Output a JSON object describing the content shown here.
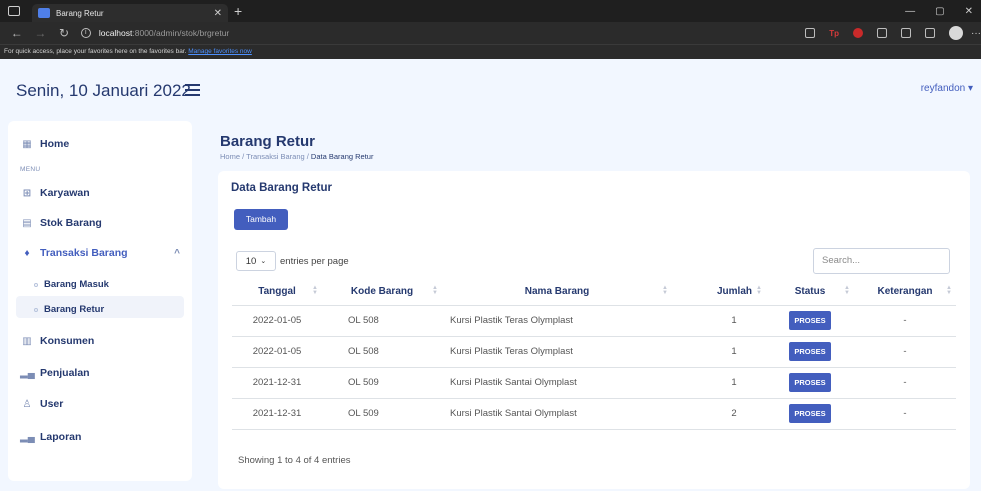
{
  "browser": {
    "tab_title": "Barang Retur",
    "url_host": "localhost",
    "url_path": ":8000/admin/stok/brgretur",
    "favbar_text": "For quick access, place your favorites here on the favorites bar.",
    "favbar_link": "Manage favorites now",
    "tp_label": "Tp"
  },
  "header": {
    "date": "Senin, 10 Januari 2022",
    "user": "reyfandon ▾"
  },
  "sidebar": {
    "home": "Home",
    "menu_label": "MENU",
    "items": [
      {
        "label": "Karyawan",
        "icon": "id-card-icon"
      },
      {
        "label": "Stok Barang",
        "icon": "keyboard-icon"
      },
      {
        "label": "Transaksi Barang",
        "icon": "gem-icon"
      },
      {
        "label": "Konsumen",
        "icon": "grid-icon"
      },
      {
        "label": "Penjualan",
        "icon": "bar-chart-icon"
      },
      {
        "label": "User",
        "icon": "person-icon"
      },
      {
        "label": "Laporan",
        "icon": "bar-chart-icon"
      }
    ],
    "sub_items": [
      "Barang Masuk",
      "Barang Retur"
    ]
  },
  "page": {
    "title": "Barang Retur",
    "breadcrumb": [
      "Home",
      "Transaksi Barang",
      "Data Barang Retur"
    ]
  },
  "card": {
    "title": "Data Barang Retur",
    "add_button": "Tambah",
    "entries_value": "10",
    "entries_label": "entries per page",
    "search_placeholder": "Search...",
    "columns": [
      "Tanggal",
      "Kode Barang",
      "Nama Barang",
      "Jumlah",
      "Status",
      "Keterangan"
    ],
    "rows": [
      {
        "tanggal": "2022-01-05",
        "kode": "OL 508",
        "nama": "Kursi Plastik Teras Olymplast",
        "jumlah": "1",
        "status": "PROSES",
        "ket": "-"
      },
      {
        "tanggal": "2022-01-05",
        "kode": "OL 508",
        "nama": "Kursi Plastik Teras Olymplast",
        "jumlah": "1",
        "status": "PROSES",
        "ket": "-"
      },
      {
        "tanggal": "2021-12-31",
        "kode": "OL 509",
        "nama": "Kursi Plastik Santai Olymplast",
        "jumlah": "1",
        "status": "PROSES",
        "ket": "-"
      },
      {
        "tanggal": "2021-12-31",
        "kode": "OL 509",
        "nama": "Kursi Plastik Santai Olymplast",
        "jumlah": "2",
        "status": "PROSES",
        "ket": "-"
      }
    ],
    "footer": "Showing 1 to 4 of 4 entries"
  },
  "colors": {
    "accent": "#435ebe",
    "text": "#25396f",
    "bg": "#f2f7ff"
  }
}
